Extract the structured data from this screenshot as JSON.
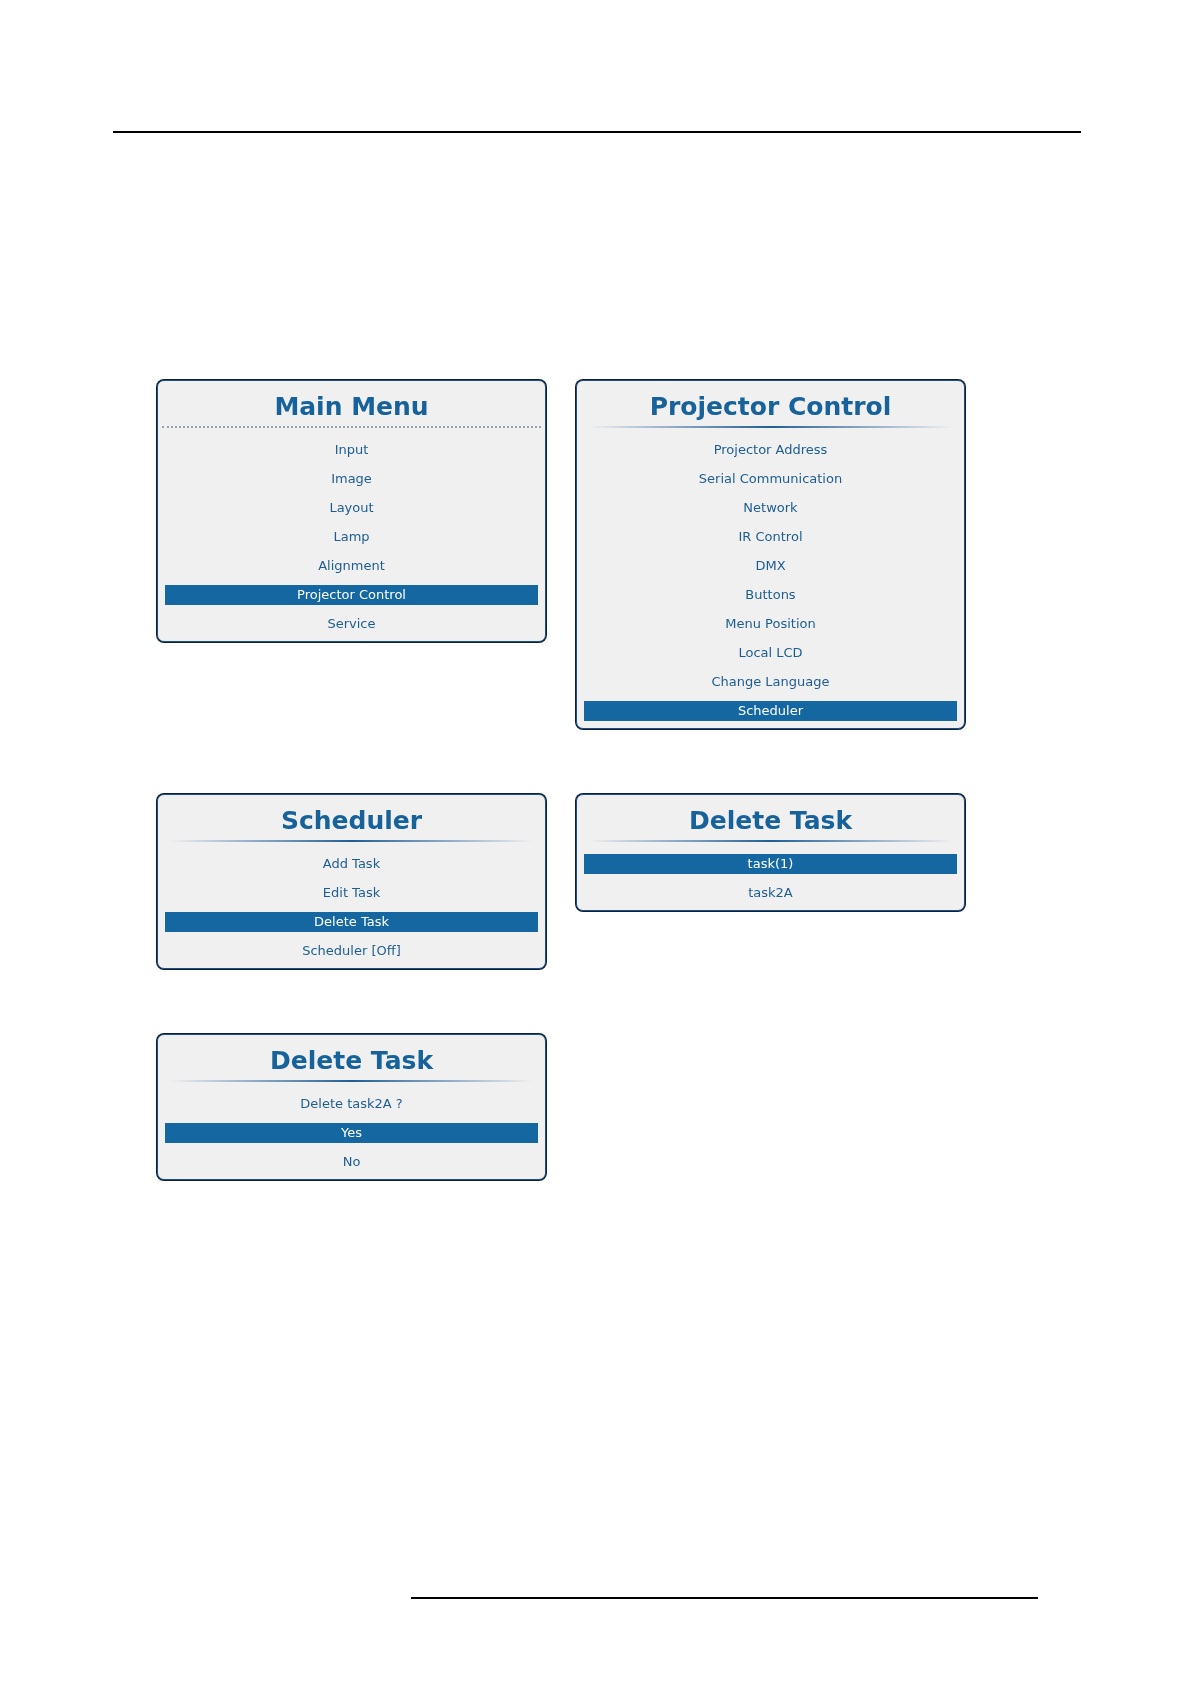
{
  "panels": [
    {
      "title": "Main Menu",
      "dotted_divider": true,
      "items": [
        {
          "label": "Input",
          "selected": false
        },
        {
          "label": "Image",
          "selected": false
        },
        {
          "label": "Layout",
          "selected": false
        },
        {
          "label": "Lamp",
          "selected": false
        },
        {
          "label": "Alignment",
          "selected": false
        },
        {
          "label": "Projector Control",
          "selected": true
        },
        {
          "label": "Service",
          "selected": false
        }
      ]
    },
    {
      "title": "Projector Control",
      "dotted_divider": false,
      "items": [
        {
          "label": "Projector Address",
          "selected": false
        },
        {
          "label": "Serial Communication",
          "selected": false
        },
        {
          "label": "Network",
          "selected": false
        },
        {
          "label": "IR Control",
          "selected": false
        },
        {
          "label": "DMX",
          "selected": false
        },
        {
          "label": "Buttons",
          "selected": false
        },
        {
          "label": "Menu Position",
          "selected": false
        },
        {
          "label": "Local LCD",
          "selected": false
        },
        {
          "label": "Change Language",
          "selected": false
        },
        {
          "label": "Scheduler",
          "selected": true
        }
      ]
    },
    {
      "title": "Scheduler",
      "dotted_divider": false,
      "items": [
        {
          "label": "Add Task",
          "selected": false
        },
        {
          "label": "Edit Task",
          "selected": false
        },
        {
          "label": "Delete Task",
          "selected": true
        },
        {
          "label": "Scheduler [Off]",
          "selected": false
        }
      ]
    },
    {
      "title": "Delete Task",
      "dotted_divider": false,
      "items": [
        {
          "label": "task(1)",
          "selected": true
        },
        {
          "label": "task2A",
          "selected": false
        }
      ]
    },
    {
      "title": "Delete Task",
      "dotted_divider": false,
      "prompt": "Delete task2A ?",
      "items": [
        {
          "label": "Yes",
          "selected": true
        },
        {
          "label": "No",
          "selected": false
        }
      ]
    }
  ]
}
